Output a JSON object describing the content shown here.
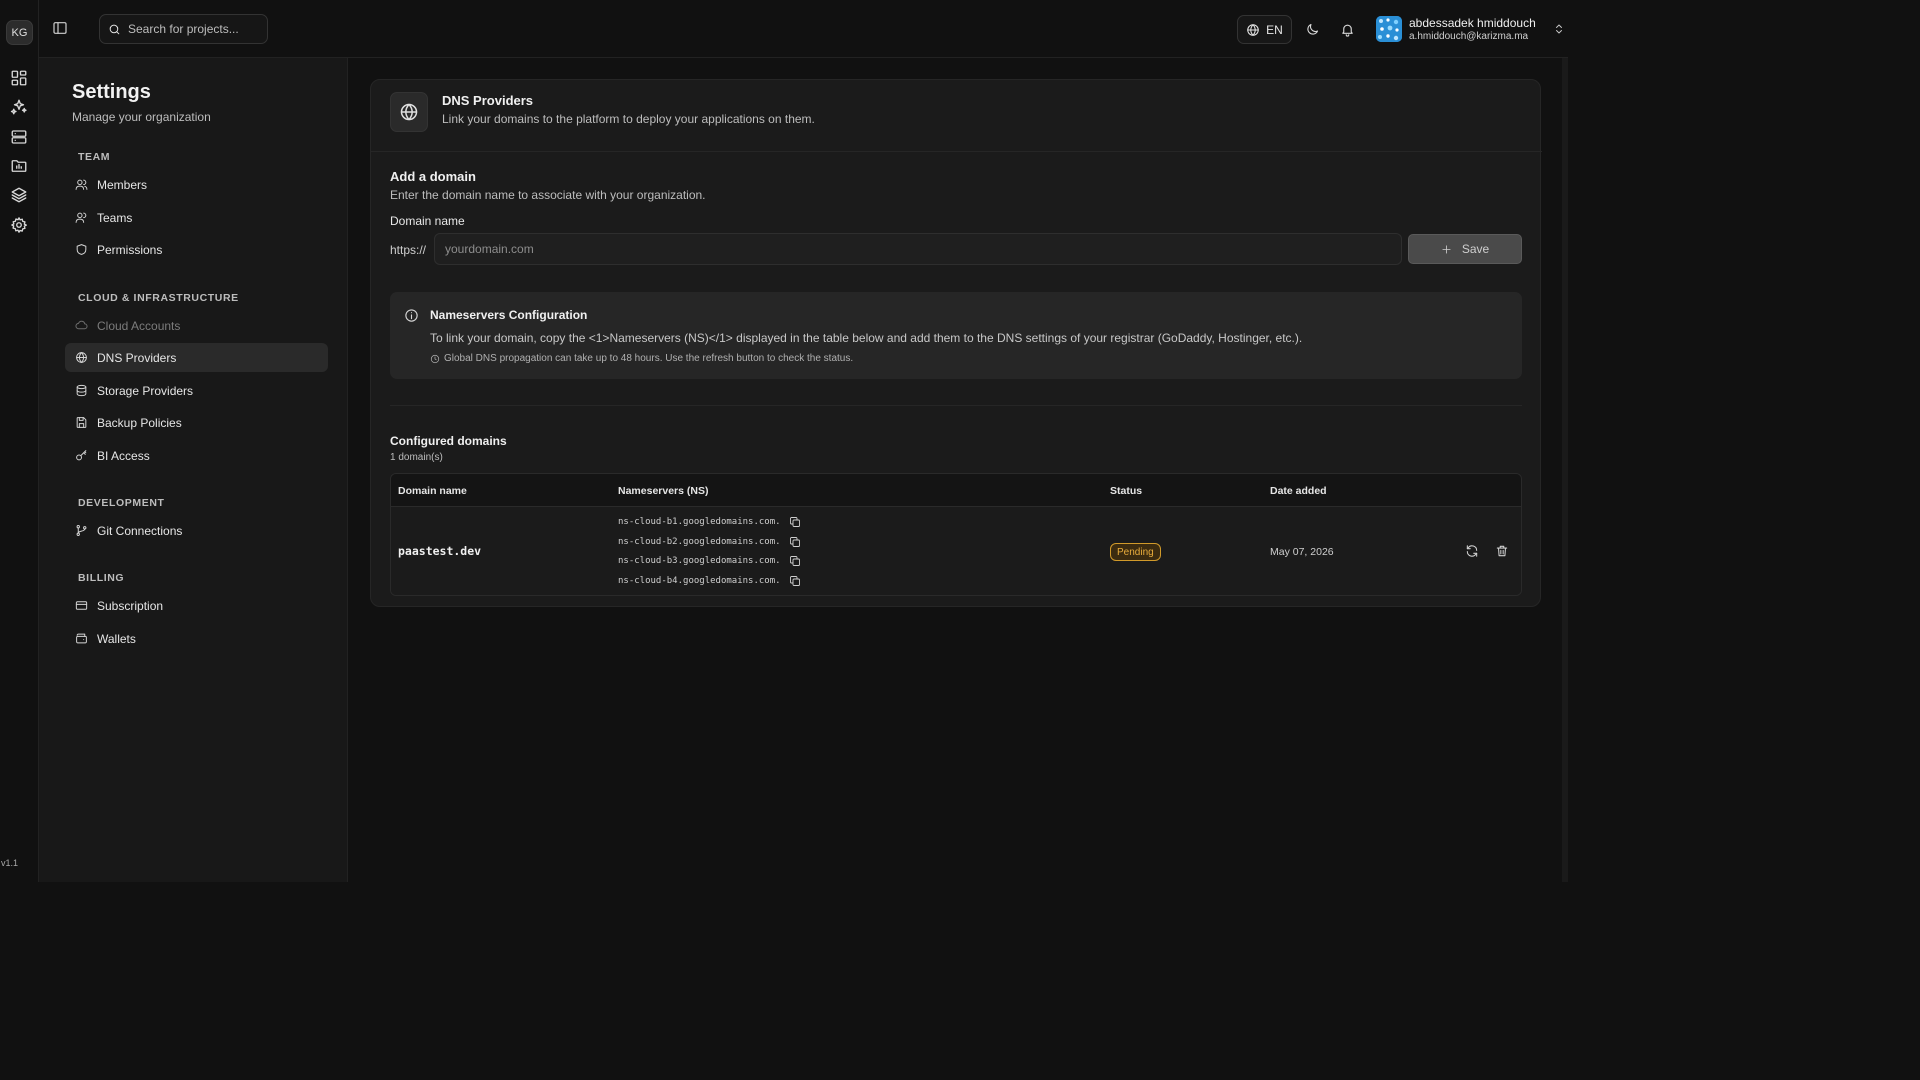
{
  "rail": {
    "logo": "KG",
    "items": [
      {
        "name": "dashboard-icon"
      },
      {
        "name": "sparkles-icon"
      },
      {
        "name": "server-icon"
      },
      {
        "name": "folder-chart-icon"
      },
      {
        "name": "layers-icon"
      },
      {
        "name": "gear-icon"
      }
    ],
    "version": "v1.1"
  },
  "topbar": {
    "search_placeholder": "Search for projects...",
    "language": "EN",
    "user": {
      "name": "abdessadek hmiddouch",
      "email": "a.hmiddouch@karizma.ma"
    }
  },
  "settings": {
    "title": "Settings",
    "subtitle": "Manage your organization",
    "sections": {
      "team": "TEAM",
      "cloud": "CLOUD & INFRASTRUCTURE",
      "development": "DEVELOPMENT",
      "billing": "BILLING"
    },
    "items": {
      "members": "Members",
      "teams": "Teams",
      "permissions": "Permissions",
      "cloud_accounts": "Cloud Accounts",
      "dns_providers": "DNS Providers",
      "storage_providers": "Storage Providers",
      "backup_policies": "Backup Policies",
      "bi_access": "BI Access",
      "git_connections": "Git Connections",
      "subscription": "Subscription",
      "wallets": "Wallets"
    },
    "active_item": "dns_providers"
  },
  "main": {
    "header": {
      "title": "DNS Providers",
      "description": "Link your domains to the platform to deploy your applications on them."
    },
    "add_domain": {
      "title": "Add a domain",
      "description": "Enter the domain name to associate with your organization.",
      "label": "Domain name",
      "prefix": "https://",
      "placeholder": "yourdomain.com",
      "value": "",
      "save_label": "Save"
    },
    "nameservers_info": {
      "title": "Nameservers Configuration",
      "description": "To link your domain, copy the <1>Nameservers (NS)</1> displayed in the table below and add them to the DNS settings of your registrar (GoDaddy, Hostinger, etc.).",
      "note": "Global DNS propagation can take up to 48 hours. Use the refresh button to check the status."
    },
    "configured": {
      "title": "Configured domains",
      "count": "1 domain(s)",
      "columns": {
        "domain": "Domain name",
        "nameservers": "Nameservers (NS)",
        "status": "Status",
        "date": "Date added"
      },
      "rows": [
        {
          "domain": "paastest.dev",
          "nameservers": [
            "ns-cloud-b1.googledomains.com.",
            "ns-cloud-b2.googledomains.com.",
            "ns-cloud-b3.googledomains.com.",
            "ns-cloud-b4.googledomains.com."
          ],
          "status": "Pending",
          "date": "May 07, 2026"
        }
      ]
    }
  },
  "colors": {
    "background": "#111111",
    "panel": "#1b1b1b",
    "sidebar": "#181818",
    "pending": "#e8ac3c"
  }
}
